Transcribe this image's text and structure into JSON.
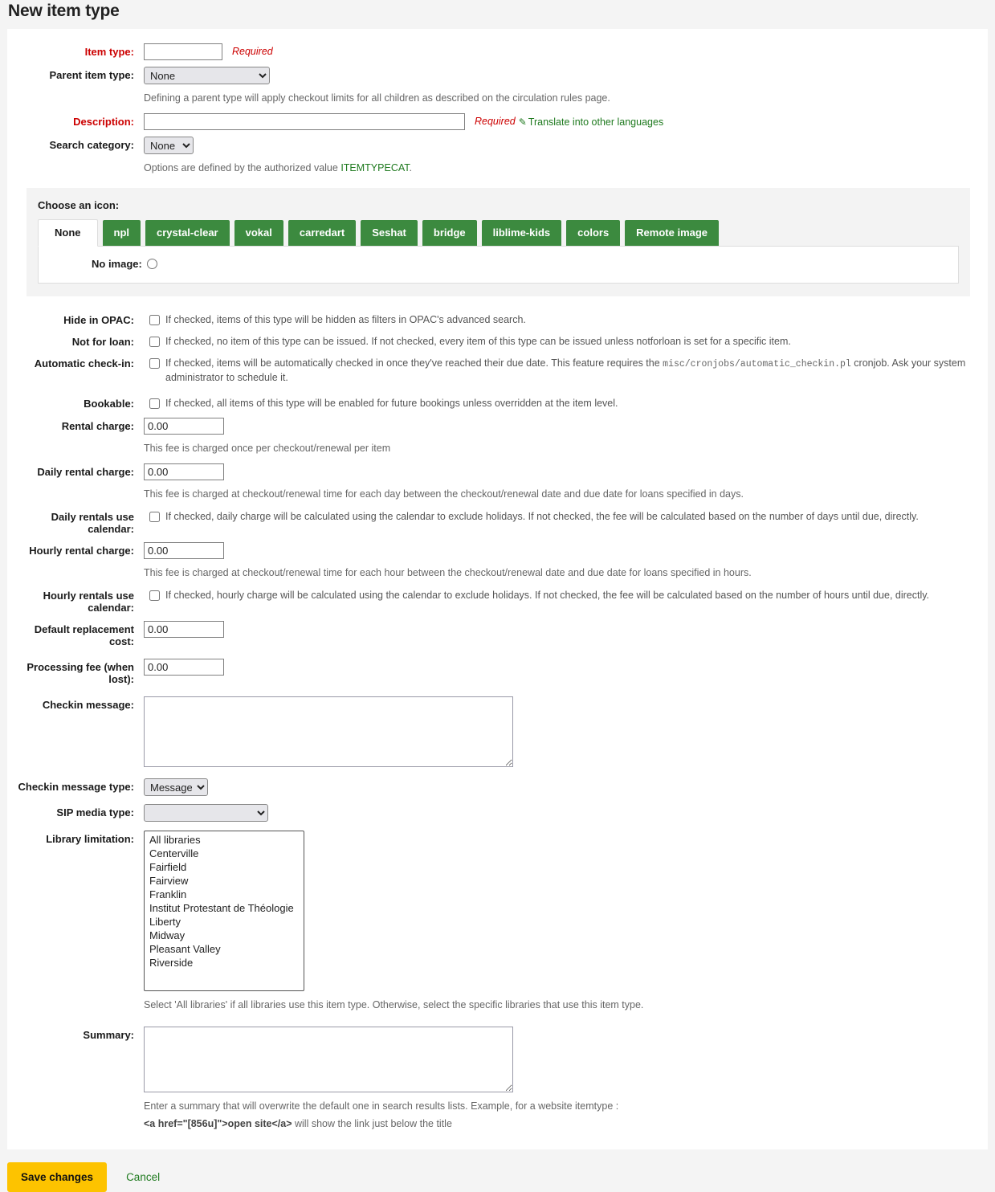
{
  "page": {
    "title": "New item type"
  },
  "labels": {
    "item_type": "Item type:",
    "parent_item_type": "Parent item type:",
    "description": "Description:",
    "search_category": "Search category:",
    "hide_in_opac": "Hide in OPAC:",
    "not_for_loan": "Not for loan:",
    "automatic_checkin": "Automatic check-in:",
    "bookable": "Bookable:",
    "rental_charge": "Rental charge:",
    "daily_rental_charge": "Daily rental charge:",
    "daily_rentals_use_calendar": "Daily rentals use calendar:",
    "hourly_rental_charge": "Hourly rental charge:",
    "hourly_rentals_use_calendar": "Hourly rentals use calendar:",
    "default_replacement_cost": "Default replacement cost:",
    "processing_fee": "Processing fee (when lost):",
    "checkin_message": "Checkin message:",
    "checkin_message_type": "Checkin message type:",
    "sip_media_type": "SIP media type:",
    "library_limitation": "Library limitation:",
    "summary": "Summary:",
    "no_image": "No image:"
  },
  "values": {
    "item_type": "",
    "parent_item_type": "None",
    "description": "",
    "search_category": "None",
    "rental_charge": "0.00",
    "daily_rental_charge": "0.00",
    "hourly_rental_charge": "0.00",
    "default_replacement_cost": "0.00",
    "processing_fee": "0.00",
    "checkin_message": "",
    "checkin_message_type": "Message",
    "sip_media_type": "",
    "summary": ""
  },
  "notes": {
    "required": "Required",
    "translate_link": "Translate into other languages",
    "parent_hint": "Defining a parent type will apply checkout limits for all children as described on the circulation rules page.",
    "search_category_hint_pre": "Options are defined by the authorized value ",
    "search_category_authval": "ITEMTYPECAT",
    "search_category_hint_post": ".",
    "hide_in_opac_hint": "If checked, items of this type will be hidden as filters in OPAC's advanced search.",
    "not_for_loan_hint": "If checked, no item of this type can be issued. If not checked, every item of this type can be issued unless notforloan is set for a specific item.",
    "automatic_checkin_hint_pre": "If checked, items will be automatically checked in once they've reached their due date. This feature requires the ",
    "automatic_checkin_cron": "misc/cronjobs/automatic_checkin.pl",
    "automatic_checkin_hint_post": " cronjob. Ask your system administrator to schedule it.",
    "bookable_hint": "If checked, all items of this type will be enabled for future bookings unless overridden at the item level.",
    "rental_charge_hint": "This fee is charged once per checkout/renewal per item",
    "daily_rental_charge_hint": "This fee is charged at checkout/renewal time for each day between the checkout/renewal date and due date for loans specified in days.",
    "daily_rentals_use_calendar_hint": "If checked, daily charge will be calculated using the calendar to exclude holidays. If not checked, the fee will be calculated based on the number of days until due, directly.",
    "hourly_rental_charge_hint": "This fee is charged at checkout/renewal time for each hour between the checkout/renewal date and due date for loans specified in hours.",
    "hourly_rentals_use_calendar_hint": "If checked, hourly charge will be calculated using the calendar to exclude holidays. If not checked, the fee will be calculated based on the number of hours until due, directly.",
    "library_limitation_hint": "Select 'All libraries' if all libraries use this item type. Otherwise, select the specific libraries that use this item type.",
    "summary_hint_1": "Enter a summary that will overwrite the default one in search results lists. Example, for a website itemtype :",
    "summary_hint_code": "<a href=\"[856u]\">open site</a>",
    "summary_hint_2": " will show the link just below the title"
  },
  "icon_chooser": {
    "legend": "Choose an icon:",
    "tabs": [
      {
        "label": "None",
        "active": true
      },
      {
        "label": "npl",
        "active": false
      },
      {
        "label": "crystal-clear",
        "active": false
      },
      {
        "label": "vokal",
        "active": false
      },
      {
        "label": "carredart",
        "active": false
      },
      {
        "label": "Seshat",
        "active": false
      },
      {
        "label": "bridge",
        "active": false
      },
      {
        "label": "liblime-kids",
        "active": false
      },
      {
        "label": "colors",
        "active": false
      },
      {
        "label": "Remote image",
        "active": false
      }
    ]
  },
  "options": {
    "parent_item_type": [
      "None"
    ],
    "search_category": [
      "None"
    ],
    "checkin_message_type": [
      "Message"
    ],
    "sip_media_type": [
      ""
    ],
    "library_limitation": [
      "All libraries",
      "Centerville",
      "Fairfield",
      "Fairview",
      "Franklin",
      "Institut Protestant de Théologie",
      "Liberty",
      "Midway",
      "Pleasant Valley",
      "Riverside"
    ]
  },
  "footer": {
    "save_label": "Save changes",
    "cancel_label": "Cancel"
  },
  "colors": {
    "tab_green": "#3c8a3f",
    "save_yellow": "#fdc300",
    "required_red": "#cc0000",
    "link_green": "#1f7a1f",
    "page_bg": "#f4f4f4"
  }
}
